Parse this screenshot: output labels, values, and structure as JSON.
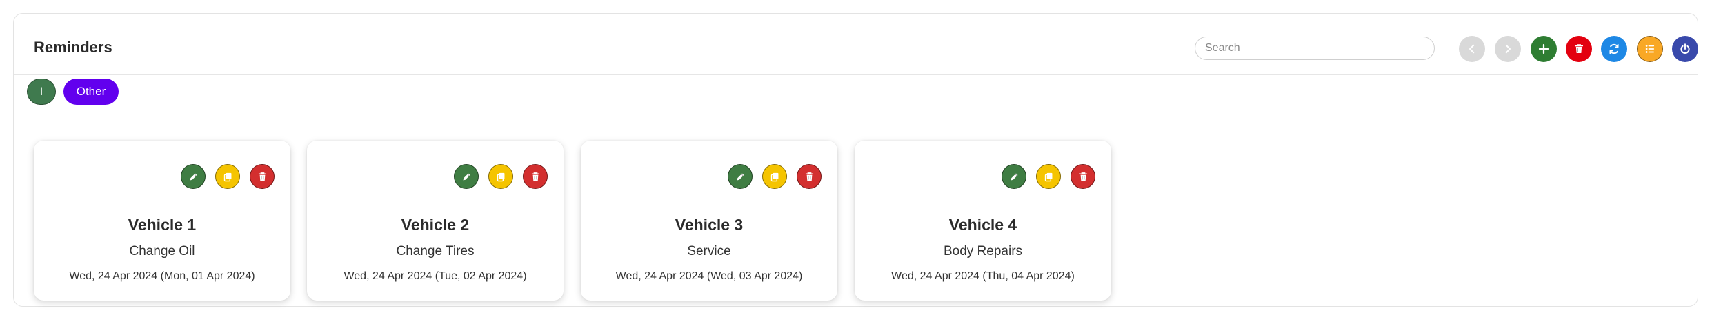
{
  "header": {
    "title": "Reminders",
    "search_placeholder": "Search"
  },
  "toolbar": [
    {
      "name": "prev-button",
      "icon": "chevron-left-icon",
      "bg": "#d9d9d9",
      "fg": "#ffffff"
    },
    {
      "name": "next-button",
      "icon": "chevron-right-icon",
      "bg": "#d9d9d9",
      "fg": "#ffffff"
    },
    {
      "name": "add-button",
      "icon": "plus-icon",
      "bg": "#2e7d32",
      "fg": "#ffffff"
    },
    {
      "name": "delete-button",
      "icon": "trash-icon",
      "bg": "#e3000f",
      "fg": "#ffffff"
    },
    {
      "name": "refresh-button",
      "icon": "refresh-icon",
      "bg": "#1e88e5",
      "fg": "#ffffff"
    },
    {
      "name": "list-button",
      "icon": "list-icon",
      "bg": "#f9a825",
      "fg": "#ffffff"
    },
    {
      "name": "power-button",
      "icon": "power-icon",
      "bg": "#3949ab",
      "fg": "#ffffff"
    }
  ],
  "filters": [
    {
      "label": "I",
      "bg": "#3f7a4e"
    },
    {
      "label": "Other",
      "bg": "#6200ee"
    }
  ],
  "card_actions": [
    {
      "name": "edit-button",
      "icon": "pencil-icon",
      "bg": "#3f7d43"
    },
    {
      "name": "copy-button",
      "icon": "copy-icon",
      "bg": "#f5c400"
    },
    {
      "name": "delete-button",
      "icon": "trash-icon",
      "bg": "#d32f2f"
    }
  ],
  "reminders": [
    {
      "vehicle": "Vehicle 1",
      "task": "Change Oil",
      "date": "Wed, 24 Apr 2024 (Mon, 01 Apr 2024)"
    },
    {
      "vehicle": "Vehicle 2",
      "task": "Change Tires",
      "date": "Wed, 24 Apr 2024 (Tue, 02 Apr 2024)"
    },
    {
      "vehicle": "Vehicle 3",
      "task": "Service",
      "date": "Wed, 24 Apr 2024 (Wed, 03 Apr 2024)"
    },
    {
      "vehicle": "Vehicle 4",
      "task": "Body Repairs",
      "date": "Wed, 24 Apr 2024 (Thu, 04 Apr 2024)"
    }
  ]
}
